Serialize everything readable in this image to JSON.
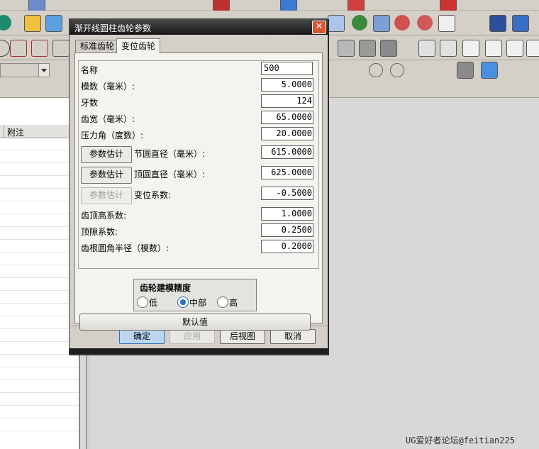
{
  "dialog": {
    "title": "渐开线圆柱齿轮参数",
    "close_glyph": "✕",
    "tabs": [
      {
        "label": "标准齿轮",
        "active": false
      },
      {
        "label": "变位齿轮",
        "active": true
      }
    ],
    "fields": {
      "name": {
        "label": "名称",
        "value": "500"
      },
      "module": {
        "label": "模数（毫米）:",
        "value": "5.0000"
      },
      "teeth": {
        "label": "牙数",
        "value": "124"
      },
      "face_width": {
        "label": "齿宽（毫米）:",
        "value": "65.0000"
      },
      "pressure_angle": {
        "label": "压力角（度数）:",
        "value": "20.0000"
      },
      "pitch_diameter": {
        "label": "节圆直径（毫米）:",
        "value": "615.0000"
      },
      "tip_diameter": {
        "label": "顶圆直径（毫米）:",
        "value": "625.0000"
      },
      "shift_coefficient": {
        "label": "变位系数:",
        "value": "-0.5000"
      },
      "addendum_coefficient": {
        "label": "齿顶高系数:",
        "value": "1.0000"
      },
      "clearance_coefficient": {
        "label": "顶隙系数:",
        "value": "0.2500"
      },
      "root_fillet": {
        "label": "齿根圆角半径（模数）:",
        "value": "0.2000"
      }
    },
    "estimate_buttons": [
      {
        "label": "参数估计",
        "enabled": true
      },
      {
        "label": "参数估计",
        "enabled": true
      },
      {
        "label": "参数估计",
        "enabled": false
      }
    ],
    "precision": {
      "title": "齿轮建模精度",
      "options": [
        {
          "label": "低",
          "selected": false
        },
        {
          "label": "中部",
          "selected": true
        },
        {
          "label": "高",
          "selected": false
        }
      ]
    },
    "default_button": "默认值",
    "footer": {
      "ok": "确定",
      "apply": "应用",
      "back": "后视图",
      "cancel": "取消"
    }
  },
  "side_panel": {
    "column_header": "附注"
  },
  "watermark": "UG爱好者论坛@feitian225",
  "colors": {
    "accent": "#2a6fc9",
    "close_button": "#d9542f",
    "titlebar": "#161616"
  }
}
